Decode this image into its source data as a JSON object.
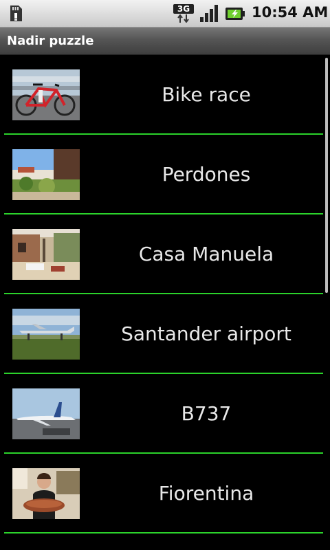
{
  "status_bar": {
    "network": "3G",
    "time": "10:54 AM",
    "icons": [
      "sd-card-icon",
      "network-3g-icon",
      "signal-icon",
      "battery-icon"
    ]
  },
  "app": {
    "title": "Nadir puzzle"
  },
  "list": {
    "items": [
      {
        "label": "Bike race",
        "thumbnail": "bike-race-thumbnail"
      },
      {
        "label": "Perdones",
        "thumbnail": "perdones-thumbnail"
      },
      {
        "label": "Casa Manuela",
        "thumbnail": "casa-manuela-thumbnail"
      },
      {
        "label": "Santander airport",
        "thumbnail": "santander-airport-thumbnail"
      },
      {
        "label": "B737",
        "thumbnail": "b737-thumbnail"
      },
      {
        "label": "Fiorentina",
        "thumbnail": "fiorentina-thumbnail"
      }
    ]
  },
  "colors": {
    "divider": "#2bd32b",
    "background": "#000000",
    "text": "#e8e8e8"
  }
}
